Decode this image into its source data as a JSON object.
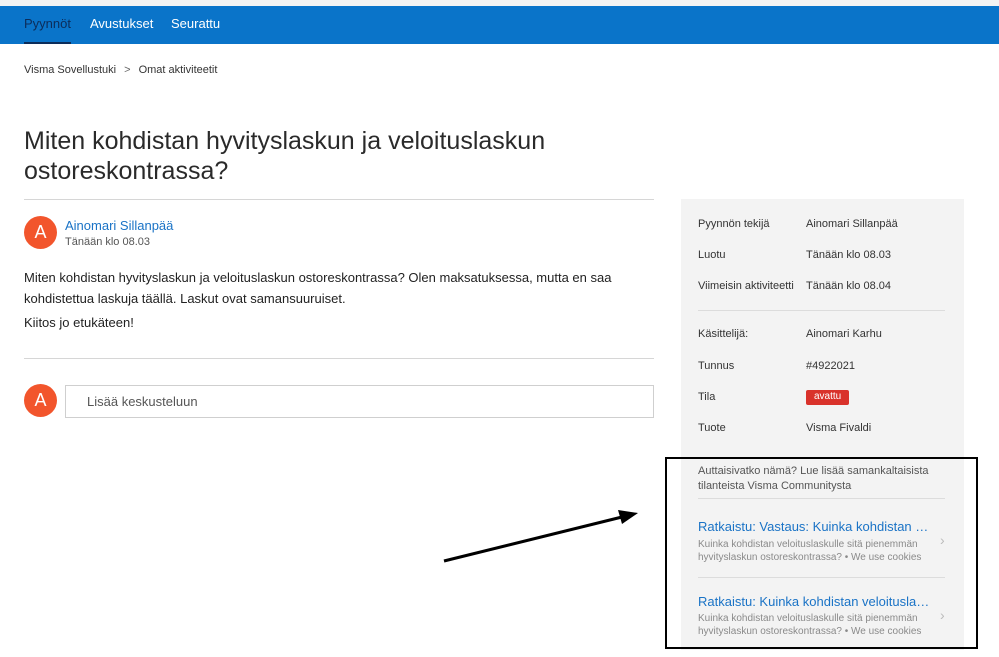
{
  "nav": {
    "tabs": [
      {
        "label": "Pyynnöt",
        "active": true
      },
      {
        "label": "Avustukset",
        "active": false
      },
      {
        "label": "Seurattu",
        "active": false
      }
    ]
  },
  "breadcrumb": {
    "items": [
      "Visma Sovellustuki",
      "Omat aktiviteetit"
    ],
    "separator": ">"
  },
  "request": {
    "title": "Miten kohdistan hyvityslaskun ja veloituslaskun ostoreskontrassa?",
    "author": {
      "initial": "A",
      "name": "Ainomari Sillanpää",
      "time": "Tänään klo 08.03"
    },
    "body": "Miten kohdistan hyvityslaskun ja veloituslaskun ostoreskontrassa? Olen maksatuksessa, mutta en saa kohdistettua laskuja täällä. Laskut ovat samansuuruiset.",
    "thanks": "Kiitos jo etukäteen!"
  },
  "comment": {
    "avatar_initial": "A",
    "placeholder": "Lisää keskusteluun"
  },
  "sidebar": {
    "requester_label": "Pyynnön tekijä",
    "requester_value": "Ainomari Sillanpää",
    "created_label": "Luotu",
    "created_value": "Tänään klo 08.03",
    "activity_label": "Viimeisin aktiviteetti",
    "activity_value": "Tänään klo 08.04",
    "assignee_label": "Käsittelijä:",
    "assignee_value": "Ainomari Karhu",
    "id_label": "Tunnus",
    "id_value": "#4922021",
    "status_label": "Tila",
    "status_value": "avattu",
    "product_label": "Tuote",
    "product_value": "Visma Fivaldi"
  },
  "related": {
    "intro": "Auttaisivatko nämä? Lue lisää samankaltaisista tilanteista Visma Communitysta",
    "items": [
      {
        "title": "Ratkaistu: Vastaus: Kuinka kohdistan veloituslaskulle sitä pienemmän hyvityslaskun",
        "desc": "Kuinka kohdistan veloituslaskulle sitä pienemmän hyvityslaskun ostoreskontrassa? • We use cookies"
      },
      {
        "title": "Ratkaistu: Kuinka kohdistan veloituslaskulle sitä pienemmän hyvityslaskun",
        "desc": "Kuinka kohdistan veloituslaskulle sitä pienemmän hyvityslaskun ostoreskontrassa? • We use cookies"
      }
    ]
  },
  "colors": {
    "nav_bg": "#0a74c9",
    "link": "#1a73c6",
    "avatar": "#f2552c",
    "status_badge": "#d9322b",
    "sidebar_bg": "#f3f3f3"
  }
}
